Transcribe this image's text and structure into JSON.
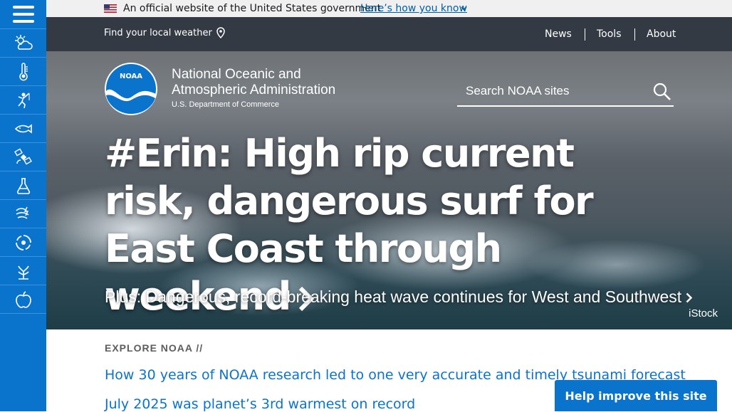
{
  "gov_banner": {
    "text": "An official website of the United States government",
    "link": "Here’s how you know"
  },
  "topnav": {
    "local_weather": "Find your local weather",
    "links": [
      "News",
      "Tools",
      "About"
    ]
  },
  "sidebar": {
    "items": [
      "menu-icon",
      "weather-icon",
      "temperature-icon",
      "fishing-icon",
      "fish-icon",
      "satellite-icon",
      "science-icon",
      "storm-icon",
      "hurricane-icon",
      "coral-icon",
      "apple-icon"
    ]
  },
  "header": {
    "org_line1": "National Oceanic and",
    "org_line2": "Atmospheric Administration",
    "dept": "U.S. Department of Commerce",
    "logo_text": "NOAA",
    "search_placeholder": "Search NOAA sites"
  },
  "hero": {
    "headline": "#Erin: High rip current risk, dangerous surf for East Coast through weekend",
    "subhead": "Plus: Dangerous, record-breaking heat wave continues for West and Southwest",
    "credit": "iStock"
  },
  "explore": {
    "label": "EXPLORE NOAA //",
    "stories": [
      "How 30 years of NOAA research led to one very accurate and timely tsunami forecast",
      "July 2025 was planet’s 3rd warmest on record"
    ]
  },
  "feedback": {
    "label": "Help improve this site"
  },
  "colors": {
    "brand_blue": "#0a74cc",
    "nav_dark": "#333a44",
    "banner_bg": "#f0f0f0"
  }
}
